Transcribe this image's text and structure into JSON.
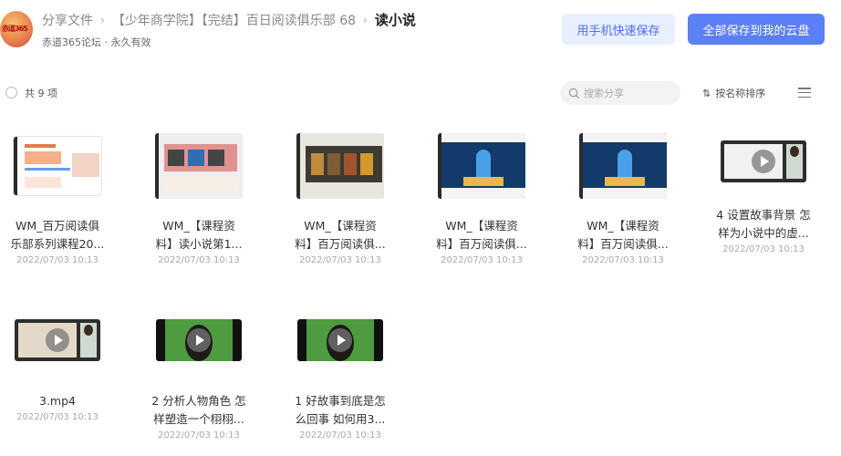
{
  "header": {
    "avatar_text": "赤道365",
    "breadcrumbs": [
      "分享文件",
      "【少年商学院】【完结】百日阅读俱乐部 68"
    ],
    "current": "读小说",
    "sharer": "赤道365论坛 · 永久有效",
    "phone_save_label": "用手机快速保存",
    "save_all_label": "全部保存到我的云盘"
  },
  "toolbar": {
    "count_label": "共 9 项",
    "search_placeholder": "搜索分享",
    "sort_label": "按名称排序"
  },
  "files": [
    {
      "name_line1": "WM_百万阅读俱",
      "name_line2": "乐部系列课程20...",
      "date": "2022/07/03 10:13"
    },
    {
      "name_line1": "WM_【课程资",
      "name_line2": "料】读小说第1...",
      "date": "2022/07/03 10:13"
    },
    {
      "name_line1": "WM_【课程资",
      "name_line2": "料】百万阅读俱...",
      "date": "2022/07/03 10:13"
    },
    {
      "name_line1": "WM_【课程资",
      "name_line2": "料】百万阅读俱...",
      "date": "2022/07/03 10:13"
    },
    {
      "name_line1": "WM_【课程资",
      "name_line2": "料】百万阅读俱...",
      "date": "2022/07/03 10:13"
    },
    {
      "name_line1": "4 设置故事背景 怎",
      "name_line2": "样为小说中的虚...",
      "date": "2022/07/03 10:13"
    },
    {
      "name_line1": "3.mp4",
      "name_line2": "",
      "date": "2022/07/03 10:13"
    },
    {
      "name_line1": "2 分析人物角色 怎",
      "name_line2": "样塑造一个栩栩...",
      "date": "2022/07/03 10:13"
    },
    {
      "name_line1": "1 好故事到底是怎",
      "name_line2": "么回事 如何用3...",
      "date": "2022/07/03 10:13"
    }
  ],
  "colors": {
    "primary": "#5b7ff6",
    "primary_light": "#e8efff"
  }
}
